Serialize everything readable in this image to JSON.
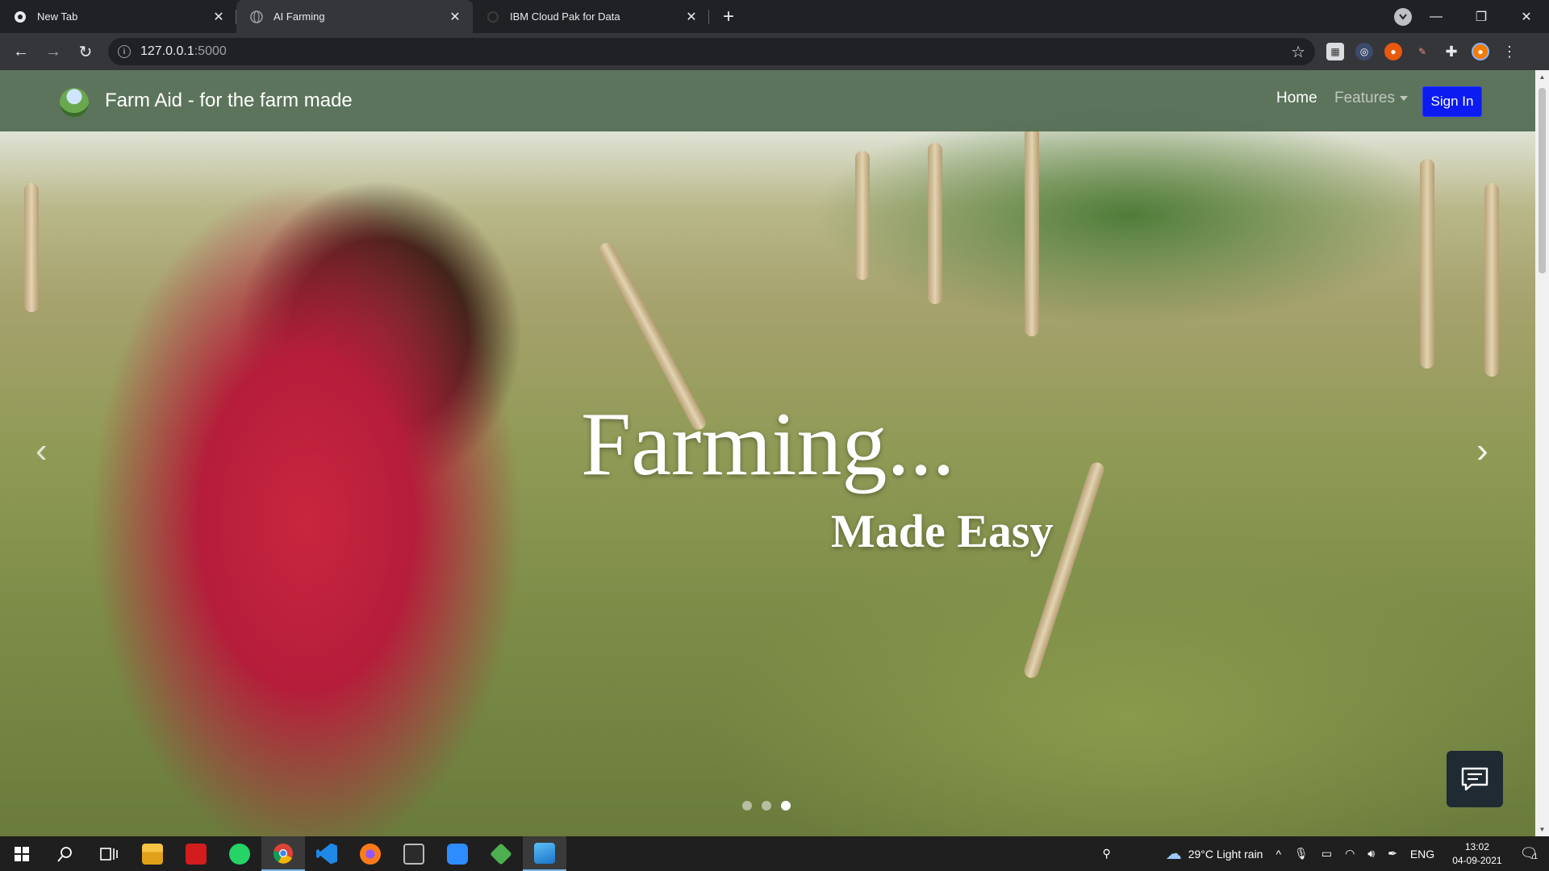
{
  "browser": {
    "tabs": [
      {
        "title": "New Tab",
        "icon": "chrome-icon",
        "active": false
      },
      {
        "title": "AI Farming",
        "icon": "globe-icon",
        "active": true
      },
      {
        "title": "IBM Cloud Pak for Data",
        "icon": "ibm-icon",
        "active": false
      }
    ],
    "address": {
      "host": "127.0.0.1",
      "port": ":5000"
    }
  },
  "navbar": {
    "brand": "Farm Aid - for the farm made",
    "home": "Home",
    "features": "Features",
    "signin": "Sign In"
  },
  "hero": {
    "caption_line1": "Farming...",
    "caption_line2": "Made Easy",
    "slide_count": 3,
    "active_slide": 3
  },
  "taskbar": {
    "weather": "29°C  Light rain",
    "language": "ENG",
    "time": "13:02",
    "date": "04-09-2021",
    "notifications": "1",
    "colors": {
      "chrome": "#e8b33a",
      "vscode": "#1e88e5",
      "firefox": "#ff7a18",
      "zoom": "#2d8cff"
    }
  }
}
